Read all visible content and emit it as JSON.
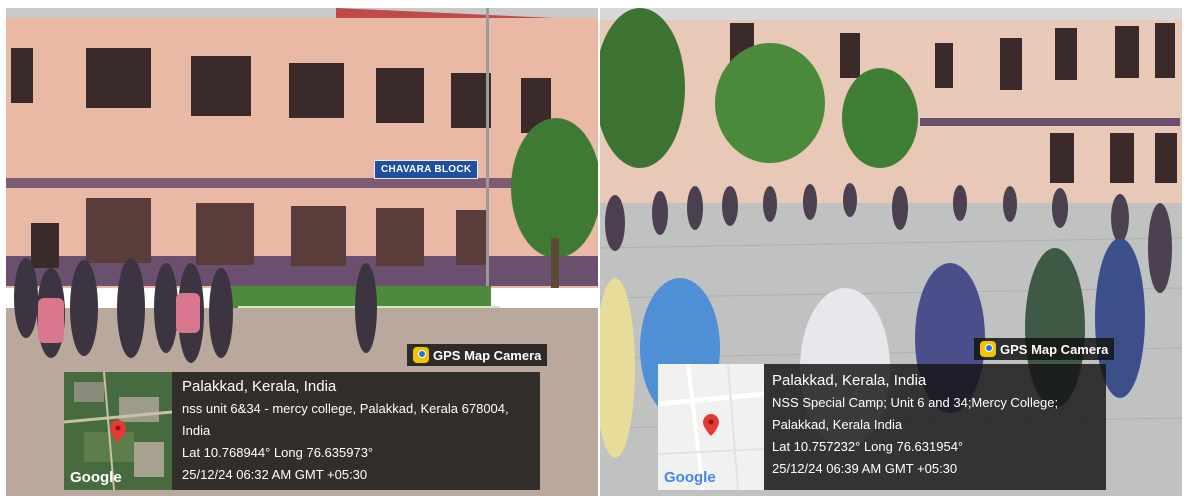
{
  "left_photo": {
    "sign_text": "CHAVARA BLOCK",
    "badge": "GPS Map Camera",
    "location": "Palakkad, Kerala, India",
    "address_1": "nss unit 6&34 - mercy college, Palakkad, Kerala 678004,",
    "address_2": "India",
    "coords": "Lat 10.768944° Long 76.635973°",
    "datetime": "25/12/24 06:32 AM GMT +05:30",
    "map_logo": "Google",
    "map_style": "satellite"
  },
  "right_photo": {
    "badge": "GPS Map Camera",
    "location": "Palakkad, Kerala, India",
    "address_1": "NSS Special Camp; Unit 6 and 34;Mercy College;",
    "address_2": "Palakkad, Kerala India",
    "coords": "Lat 10.757232° Long 76.631954°",
    "datetime": "25/12/24 06:39 AM GMT +05:30",
    "map_logo": "Google",
    "map_style": "road"
  },
  "colors": {
    "building": "#e9b9a6",
    "trim": "#6b4f6e",
    "pin": "#e53935",
    "map_label": "#4285f4"
  }
}
